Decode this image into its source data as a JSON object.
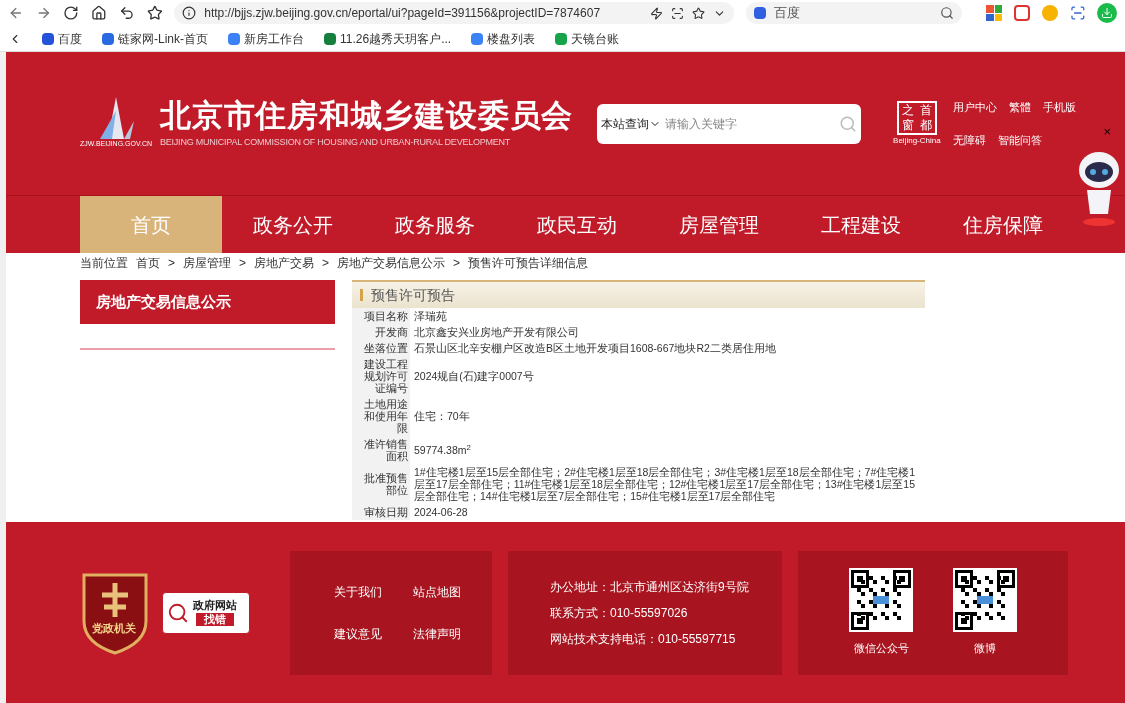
{
  "browser": {
    "url": "http://bjjs.zjw.beijing.gov.cn/eportal/ui?pageId=391156&projectID=7874607",
    "search_engine": "百度",
    "bookmarks": [
      "百度",
      "链家网-Link-首页",
      "新房工作台",
      "11.26越秀天玥客户...",
      "楼盘列表",
      "天镜台账"
    ]
  },
  "header": {
    "logo_domain": "ZJW.BEIJING.GOV.CN",
    "title": "北京市住房和城乡建设委员会",
    "subtitle": "BEIJING MUNICIPAL COMMISSION OF HOUSING AND URBAN-RURAL DEVELOPMENT",
    "search": {
      "scope": "本站查询",
      "placeholder": "请输入关键字"
    },
    "portal_logo": {
      "chars": [
        "之",
        "首",
        "窗",
        "都"
      ],
      "caption": "Beijing-China"
    },
    "links": [
      "用户中心",
      "繁體",
      "手机版",
      "无障碍",
      "智能问答"
    ],
    "assistant_close": "×"
  },
  "nav": [
    {
      "label": "首页",
      "selected": true
    },
    {
      "label": "政务公开",
      "selected": false
    },
    {
      "label": "政务服务",
      "selected": false
    },
    {
      "label": "政民互动",
      "selected": false
    },
    {
      "label": "房屋管理",
      "selected": false
    },
    {
      "label": "工程建设",
      "selected": false
    },
    {
      "label": "住房保障",
      "selected": false
    }
  ],
  "breadcrumb": {
    "label": "当前位置",
    "items": [
      "首页",
      "房屋管理",
      "房地产交易",
      "房地产交易信息公示",
      "预售许可预告详细信息"
    ],
    "separator": ">"
  },
  "sidebar": {
    "title": "房地产交易信息公示"
  },
  "detail": {
    "title": "预售许可预告",
    "rows": [
      {
        "label": "项目名称",
        "value": "泽瑞苑"
      },
      {
        "label": "开发商",
        "value": "北京鑫安兴业房地产开发有限公司"
      },
      {
        "label": "坐落位置",
        "value": "石景山区北辛安棚户区改造B区土地开发项目1608-667地块R2二类居住用地"
      },
      {
        "label": "建设工程规划许可证编号",
        "value": "2024规自(石)建字0007号"
      },
      {
        "label": "土地用途和使用年限",
        "value": "住宅：70年"
      },
      {
        "label": "准许销售面积",
        "value": "59774.38m$^{2}$"
      },
      {
        "label": "批准预售部位",
        "value": "1#住宅楼1层至15层全部住宅；2#住宅楼1层至18层全部住宅；3#住宅楼1层至18层全部住宅；7#住宅楼1层至17层全部住宅；11#住宅楼1层至18层全部住宅；12#住宅楼1层至17层全部住宅；13#住宅楼1层至15层全部住宅；14#住宅楼1层至7层全部住宅；15#住宅楼1层至17层全部住宅"
      },
      {
        "label": "审核日期",
        "value": "2024-06-28"
      }
    ]
  },
  "footer": {
    "badge": "党政机关",
    "error_report": [
      "政府网站",
      "找错"
    ],
    "links": [
      "关于我们",
      "站点地图",
      "建议意见",
      "法律声明"
    ],
    "contact": [
      "办公地址：北京市通州区达济街9号院",
      "联系方式：010-55597026",
      "网站技术支持电话：010-55597715"
    ],
    "qr_codes": [
      "微信公众号",
      "微博"
    ]
  }
}
